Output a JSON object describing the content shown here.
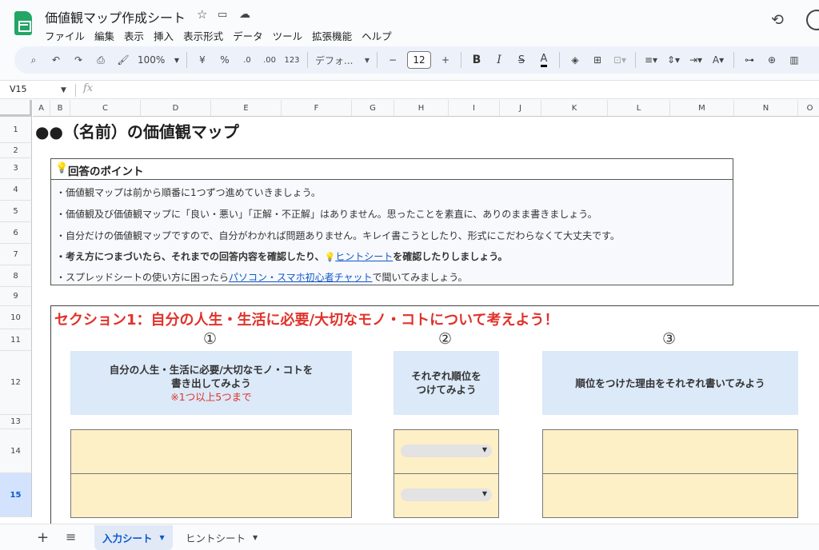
{
  "app": {
    "title": "価値観マップ作成シート",
    "icons": [
      "star-icon",
      "folder-move-icon",
      "cloud-status-icon",
      "history-icon"
    ]
  },
  "menu": [
    "ファイル",
    "編集",
    "表示",
    "挿入",
    "表示形式",
    "データ",
    "ツール",
    "拡張機能",
    "ヘルプ"
  ],
  "toolbar": {
    "zoom": "100%",
    "currency": "¥",
    "percent": "%",
    "dec_minus": ".0",
    "dec_plus": ".00",
    "number_format": "123",
    "font": "デフォ...",
    "font_size": "12"
  },
  "formula_bar": {
    "cell_ref": "V15",
    "fx": "fx",
    "value": ""
  },
  "columns": [
    "A",
    "B",
    "C",
    "D",
    "E",
    "F",
    "G",
    "H",
    "I",
    "J",
    "K",
    "L",
    "M",
    "N",
    "O"
  ],
  "rows": [
    "1",
    "2",
    "3",
    "4",
    "5",
    "6",
    "7",
    "8",
    "9",
    "10",
    "11",
    "12",
    "13",
    "14",
    "15"
  ],
  "selected_row": "15",
  "sheet": {
    "title": "●●（名前）の価値観マップ",
    "points": {
      "header": "回答のポイント",
      "line1": "・価値観マップは前から順番に1つずつ進めていきましょう。",
      "line2": "・価値観及び価値観マップに「良い・悪い」「正解・不正解」はありません。思ったことを素直に、ありのまま書きましょう。",
      "line3": "・自分だけの価値観マップですので、自分がわかれば問題ありません。キレイ書こうとしたり、形式にこだわらなくて大丈夫です。",
      "line4_a": "・考え方につまづいたら、それまでの回答内容を確認したり、",
      "line4_link": "ヒントシート",
      "line4_b": "を確認したりしましょう。",
      "line5_a": "・スプレッドシートの使い方に困ったら",
      "line5_link": "パソコン・スマホ初心者チャット",
      "line5_b": "で聞いてみましょう。"
    },
    "section1": {
      "title": "セクション1：自分の人生・生活に必要/大切なモノ・コトについて考えよう！",
      "step1": "①",
      "step2": "②",
      "step3": "③",
      "q1_line1": "自分の人生・生活に必要/大切なモノ・コトを",
      "q1_line2": "書き出してみよう",
      "q1_note": "※1つ以上5つまで",
      "q2_line1": "それぞれ順位を",
      "q2_line2": "つけてみよう",
      "q3": "順位をつけた理由をそれぞれ書いてみよう"
    }
  },
  "tabs": {
    "active": "入力シート",
    "other": "ヒントシート"
  },
  "colors": {
    "accent_red": "#e0322a",
    "question_blue": "#dbe9f8",
    "answer_yellow": "#fdefc6",
    "link": "#1155cc"
  }
}
